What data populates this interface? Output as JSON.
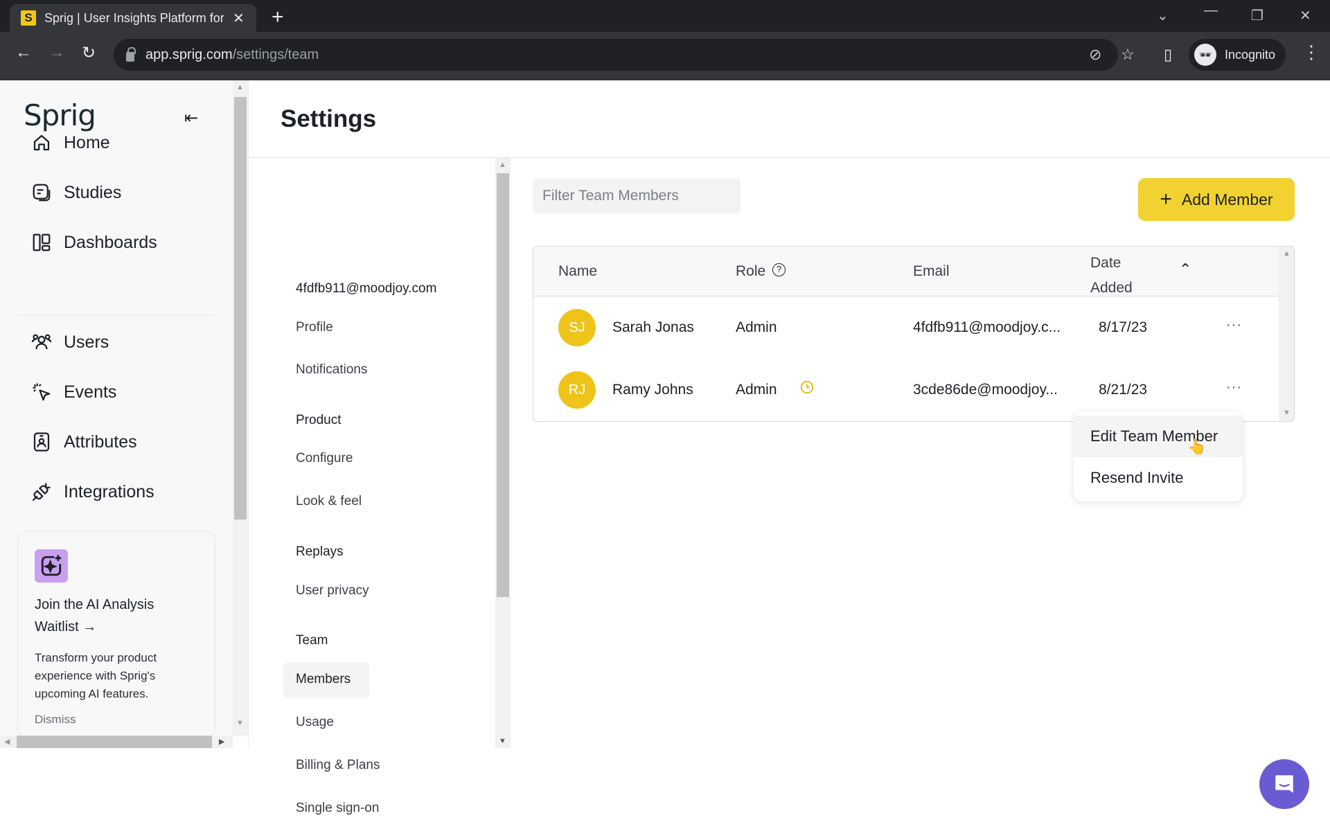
{
  "browser": {
    "tab_title": "Sprig | User Insights Platform for",
    "favicon_letter": "S",
    "url_host": "app.sprig.com",
    "url_path": "/settings/team",
    "profile_label": "Incognito"
  },
  "sidebar": {
    "logo": "Sprig",
    "items": [
      {
        "label": "Home",
        "icon": "home-icon"
      },
      {
        "label": "Studies",
        "icon": "studies-icon"
      },
      {
        "label": "Dashboards",
        "icon": "dashboards-icon"
      },
      {
        "label": "Users",
        "icon": "users-icon"
      },
      {
        "label": "Events",
        "icon": "events-icon"
      },
      {
        "label": "Attributes",
        "icon": "attributes-icon"
      },
      {
        "label": "Integrations",
        "icon": "integrations-icon"
      }
    ],
    "promo": {
      "title": "Join the AI Analysis Waitlist →",
      "body": "Transform your product experience with Sprig's upcoming AI features.",
      "dismiss": "Dismiss"
    }
  },
  "page": {
    "title": "Settings"
  },
  "settings_nav": {
    "account_email": "4fdfb911@moodjoy.com",
    "profile": "Profile",
    "notifications": "Notifications",
    "product_header": "Product",
    "configure": "Configure",
    "look_feel": "Look & feel",
    "replays_header": "Replays",
    "user_privacy": "User privacy",
    "team_header": "Team",
    "members": "Members",
    "usage": "Usage",
    "billing": "Billing & Plans",
    "sso": "Single sign-on"
  },
  "members": {
    "filter_placeholder": "Filter Team Members",
    "add_button": "Add Member",
    "columns": {
      "name": "Name",
      "role": "Role",
      "email": "Email",
      "date_added_line1": "Date",
      "date_added_line2": "Added"
    },
    "rows": [
      {
        "initials": "SJ",
        "name": "Sarah Jonas",
        "role": "Admin",
        "pending": false,
        "email": "4fdfb911@moodjoy.c...",
        "date": "8/17/23"
      },
      {
        "initials": "RJ",
        "name": "Ramy Johns",
        "role": "Admin",
        "pending": true,
        "email": "3cde86de@moodjoy...",
        "date": "8/21/23"
      }
    ],
    "more_label": "···"
  },
  "context_menu": {
    "items": [
      "Edit Team Member",
      "Resend Invite"
    ]
  },
  "colors": {
    "accent": "#f2d230",
    "avatar": "#eec41a",
    "chat": "#6b5bd2",
    "promo_icon": "#c9a0f0"
  }
}
